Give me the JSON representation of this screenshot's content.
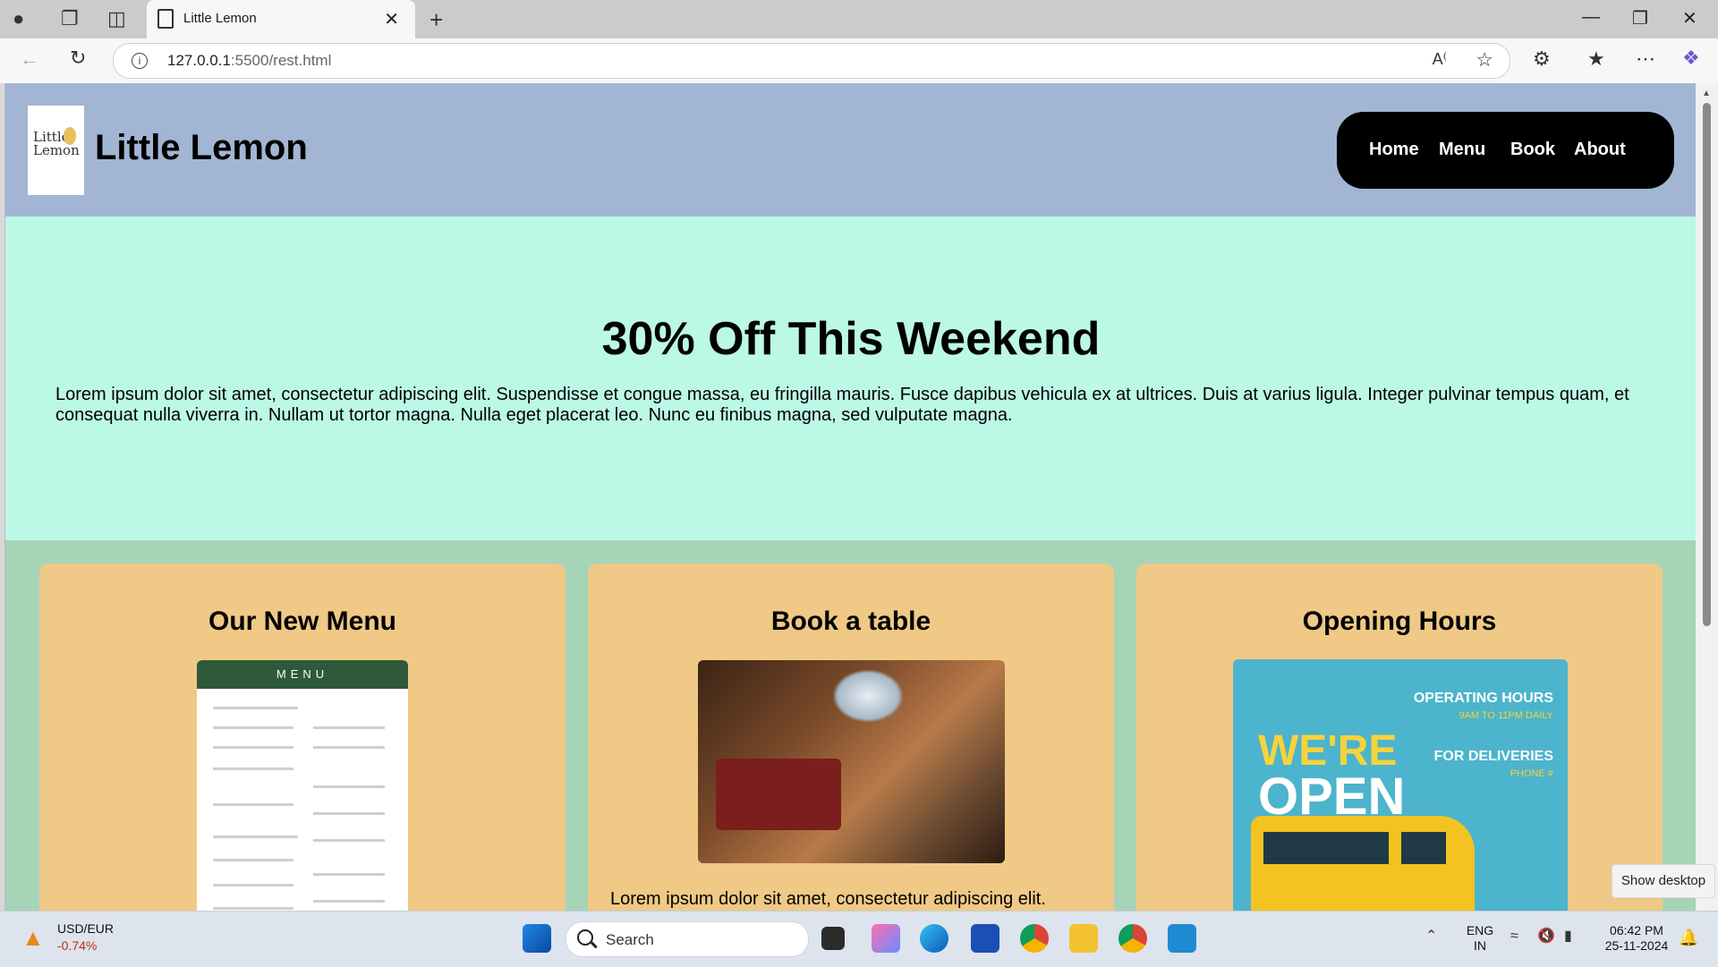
{
  "browser": {
    "tab_title": "Little Lemon",
    "url_host": "127.0.0.1",
    "url_rest": ":5500/rest.html"
  },
  "site": {
    "logo_text_1": "Little",
    "logo_text_2": "Lemon",
    "title": "Little Lemon",
    "nav": [
      "Home",
      "Menu",
      "Book",
      "About"
    ]
  },
  "promo": {
    "heading": "30% Off This Weekend",
    "body": "Lorem ipsum dolor sit amet, consectetur adipiscing elit. Suspendisse et congue massa, eu fringilla mauris. Fusce dapibus vehicula ex at ultrices. Duis at varius ligula. Integer pulvinar tempus quam, et consequat nulla viverra in. Nullam ut tortor magna. Nulla eget placerat leo. Nunc eu finibus magna, sed vulputate magna."
  },
  "cards": [
    {
      "title": "Our New Menu",
      "image_text": "MENU"
    },
    {
      "title": "Book a table",
      "text": "Lorem ipsum dolor sit amet, consectetur adipiscing elit."
    },
    {
      "title": "Opening Hours",
      "image": {
        "operating": "OPERATING HOURS",
        "hours": "9AM TO 11PM DAILY",
        "deliveries": "FOR DELIVERIES",
        "phone": "PHONE #",
        "were": "WE'RE",
        "open": "OPEN"
      }
    }
  ],
  "tooltip": "Show desktop",
  "taskbar": {
    "stock_title": "USD/EUR",
    "stock_value": "-0.74%",
    "search_placeholder": "Search",
    "lang_1": "ENG",
    "lang_2": "IN",
    "time": "06:42 PM",
    "date": "25-11-2024"
  },
  "colors": {
    "header_bg": "#a2b6d3",
    "promo_bg": "#bcf8e6",
    "section_bg": "#a6d4b7",
    "card_bg": "#efc985",
    "nav_bg": "#000000"
  }
}
